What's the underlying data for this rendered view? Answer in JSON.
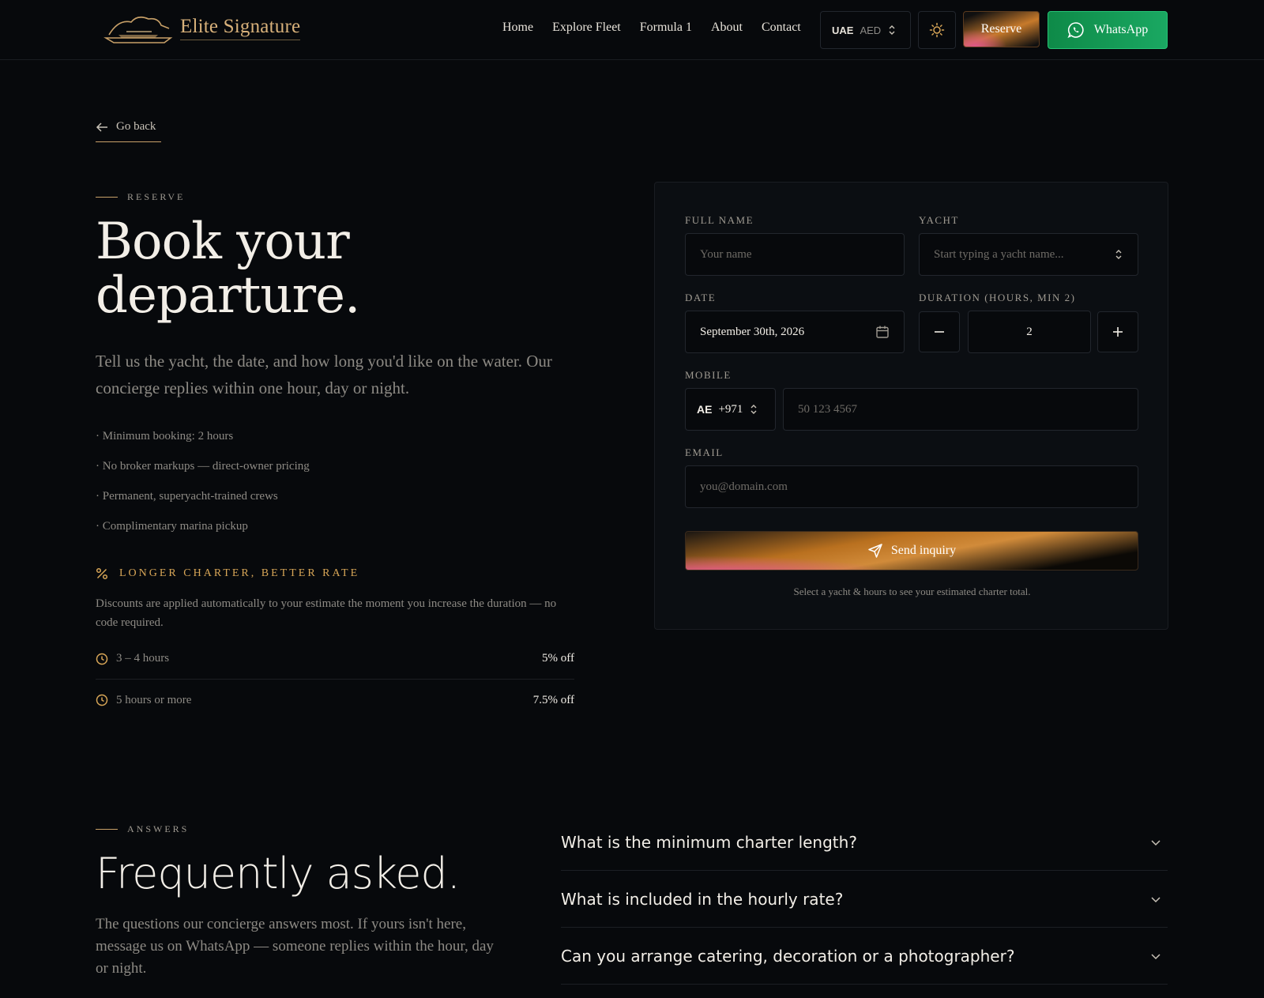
{
  "nav": {
    "brand": "Elite Signature",
    "links": [
      "Home",
      "Explore Fleet",
      "Formula 1",
      "About",
      "Contact"
    ],
    "region": "UAE",
    "currency": "AED",
    "reserve_label": "Reserve",
    "whatsapp_label": "WhatsApp"
  },
  "back_label": "Go back",
  "hero": {
    "eyebrow": "RESERVE",
    "title_line1": "Book your",
    "title_line2": "departure.",
    "subtitle": "Tell us the yacht, the date, and how long you'd like on the water. Our concierge replies within one hour, day or night.",
    "bullets": [
      "· Minimum booking: 2 hours",
      "· No broker markups — direct-owner pricing",
      "· Permanent, superyacht-trained crews",
      "· Complimentary marina pickup"
    ]
  },
  "discount": {
    "heading": "LONGER CHARTER, BETTER RATE",
    "body": "Discounts are applied automatically to your estimate the moment you increase the duration — no code required.",
    "tiers": [
      {
        "label": "3 – 4 hours",
        "value": "5% off"
      },
      {
        "label": "5 hours or more",
        "value": "7.5% off"
      }
    ]
  },
  "form": {
    "full_name_label": "FULL NAME",
    "full_name_placeholder": "Your name",
    "yacht_label": "YACHT",
    "yacht_placeholder": "Start typing a yacht name...",
    "date_label": "DATE",
    "date_value": "September 30th, 2026",
    "duration_label": "DURATION (HOURS, MIN 2)",
    "duration_value": "2",
    "mobile_label": "MOBILE",
    "country_code": "AE",
    "dial_code": "+971",
    "mobile_placeholder": "50 123 4567",
    "email_label": "EMAIL",
    "email_placeholder": "you@domain.com",
    "submit_label": "Send inquiry",
    "note": "Select a yacht & hours to see your estimated charter total."
  },
  "faq": {
    "eyebrow": "ANSWERS",
    "title": "Frequently asked.",
    "subtitle": "The questions our concierge answers most. If yours isn't here, message us on WhatsApp — someone replies within the hour, day or night.",
    "questions": [
      "What is the minimum charter length?",
      "What is included in the hourly rate?",
      "Can you arrange catering, decoration or a photographer?"
    ]
  },
  "colors": {
    "background": "#07090c",
    "accent_gold": "#c8a068",
    "whatsapp_green": "#1aa862"
  }
}
